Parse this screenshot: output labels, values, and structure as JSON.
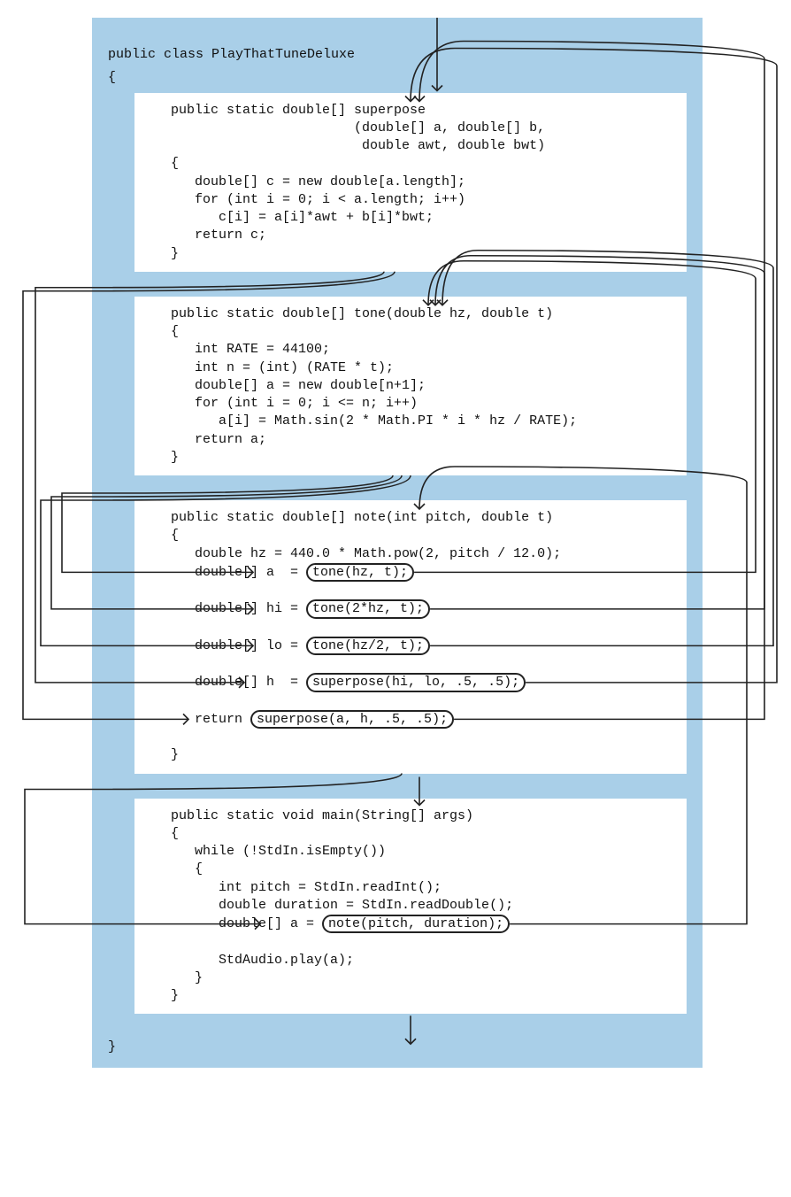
{
  "class_decl": "public class PlayThatTuneDeluxe",
  "open_brace": "{",
  "close_brace": "}",
  "methods": {
    "superpose": {
      "sig1": "   public static double[] superpose",
      "sig2": "                          (double[] a, double[] b,",
      "sig3": "                           double awt, double bwt)",
      "open": "   {",
      "l1": "      double[] c = new double[a.length];",
      "l2": "      for (int i = 0; i < a.length; i++)",
      "l3": "         c[i] = a[i]*awt + b[i]*bwt;",
      "l4": "      return c;",
      "close": "   }"
    },
    "tone": {
      "sig": "   public static double[] tone(double hz, double t)",
      "open": "   {",
      "l1": "      int RATE = 44100;",
      "l2": "      int n = (int) (RATE * t);",
      "l3": "      double[] a = new double[n+1];",
      "l4": "      for (int i = 0; i <= n; i++)",
      "l5": "         a[i] = Math.sin(2 * Math.PI * i * hz / RATE);",
      "l6": "      return a;",
      "close": "   }"
    },
    "note": {
      "sig": "   public static double[] note(int pitch, double t)",
      "open": "   {",
      "l1": "      double hz = 440.0 * Math.pow(2, pitch / 12.0);",
      "l2a": "      double[] a  = ",
      "l2b": "tone(hz, t);",
      "l3a": "      double[] hi = ",
      "l3b": "tone(2*hz, t);",
      "l4a": "      double[] lo = ",
      "l4b": "tone(hz/2, t);",
      "l5a": "      double[] h  = ",
      "l5b": "superpose(hi, lo, .5, .5);",
      "l6a": "      return ",
      "l6b": "superpose(a, h, .5, .5);",
      "close": "   }"
    },
    "main": {
      "sig": "   public static void main(String[] args)",
      "open": "   {",
      "l1": "      while (!StdIn.isEmpty())",
      "l2": "      {",
      "l3": "         int pitch = StdIn.readInt();",
      "l4": "         double duration = StdIn.readDouble();",
      "l5a": "         double[] a = ",
      "l5b": "note(pitch, duration);",
      "blank": "",
      "l6": "         StdAudio.play(a);",
      "l7": "      }",
      "close": "   }"
    }
  }
}
